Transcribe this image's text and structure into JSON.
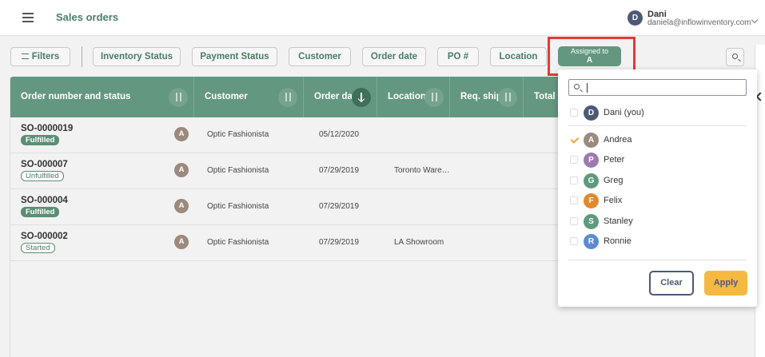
{
  "header": {
    "title": "Sales orders",
    "user": {
      "initial": "D",
      "name": "Dani",
      "email": "daniela@inflowinventory.com"
    }
  },
  "filters": {
    "filters_label": "Filters",
    "chips": [
      "Inventory Status",
      "Payment Status",
      "Customer",
      "Order date",
      "PO #",
      "Location"
    ],
    "assigned": {
      "label": "Assigned to",
      "value": "A"
    }
  },
  "table": {
    "columns": [
      "Order number and status",
      "Customer",
      "Order date",
      "Location",
      "Req. ship",
      "Total"
    ],
    "rows": [
      {
        "order": "SO-0000019",
        "status": "Fulfilled",
        "assignee": "A",
        "customer": "Optic Fashionista",
        "date": "05/12/2020",
        "location": ""
      },
      {
        "order": "SO-000007",
        "status": "Unfulfilled",
        "assignee": "A",
        "customer": "Optic Fashionista",
        "date": "07/29/2019",
        "location": "Toronto Ware…"
      },
      {
        "order": "SO-000004",
        "status": "Fulfilled",
        "assignee": "A",
        "customer": "Optic Fashionista",
        "date": "07/29/2019",
        "location": ""
      },
      {
        "order": "SO-000002",
        "status": "Started",
        "assignee": "A",
        "customer": "Optic Fashionista",
        "date": "07/29/2019",
        "location": "LA Showroom"
      }
    ]
  },
  "dropdown": {
    "search_value": "",
    "self": {
      "initial": "D",
      "name": "Dani (you)",
      "color": "#4d5a75",
      "checked": false
    },
    "users": [
      {
        "initial": "A",
        "name": "Andrea",
        "color": "#9b8a7d",
        "checked": true
      },
      {
        "initial": "P",
        "name": "Peter",
        "color": "#9c7bb0",
        "checked": false
      },
      {
        "initial": "G",
        "name": "Greg",
        "color": "#5e9a7e",
        "checked": false
      },
      {
        "initial": "F",
        "name": "Felix",
        "color": "#e08a2e",
        "checked": false
      },
      {
        "initial": "S",
        "name": "Stanley",
        "color": "#5e9a7e",
        "checked": false
      },
      {
        "initial": "R",
        "name": "Ronnie",
        "color": "#5b8bd6",
        "checked": false
      }
    ],
    "clear_label": "Clear",
    "apply_label": "Apply"
  },
  "colors": {
    "brand": "#64977f",
    "accent": "#f5b942",
    "highlight": "#e53935"
  },
  "icons": [
    "hamburger-icon",
    "chevron-down-icon",
    "filter-icon",
    "search-icon",
    "sort-icon",
    "sort-desc-icon",
    "chevron-left-icon",
    "check-icon"
  ]
}
